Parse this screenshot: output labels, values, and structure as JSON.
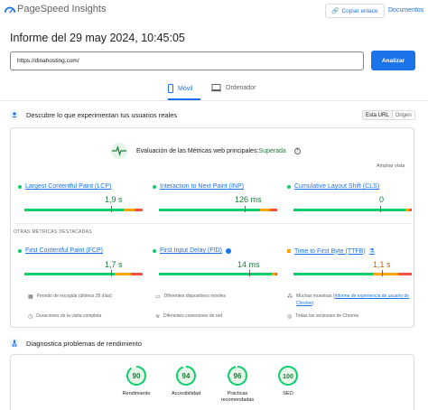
{
  "header": {
    "app_title": "PageSpeed Insights",
    "copy_link": "Copiar enlace",
    "docs": "Documentos"
  },
  "report": {
    "title": "Informe del 29 may 2024, 10:45:05"
  },
  "search": {
    "url_value": "https://dinahosting.com/",
    "analyze_label": "Analizar"
  },
  "tabs": [
    {
      "label": "Móvil",
      "active": true
    },
    {
      "label": "Ordenador",
      "active": false
    }
  ],
  "field": {
    "heading": "Descubre lo que experimentan tus usuarios reales",
    "toggle": [
      "Esta URL",
      "Origen"
    ],
    "cwv_title": "Evaluación de las Métricas web principales:",
    "cwv_status": "Superada",
    "expand": "Ampliar vista",
    "core_metrics": [
      {
        "name": "Largest Contentful Paint (LCP)",
        "value": "1,9 s",
        "indicator": "good"
      },
      {
        "name": "Interaction to Next Paint (INP)",
        "value": "126 ms",
        "indicator": "good"
      },
      {
        "name": "Cumulative Layout Shift (CLS)",
        "value": "0",
        "indicator": "good"
      }
    ],
    "other_label": "OTRAS MÉTRICAS DESTACADAS",
    "other_metrics": [
      {
        "name": "First Contentful Paint (FCP)",
        "value": "1,7 s",
        "indicator": "good"
      },
      {
        "name": "First Input Delay (FID)",
        "value": "14 ms",
        "indicator": "good"
      },
      {
        "name": "Time to First Byte (TTFB)",
        "value": "1,1 s",
        "indicator": "average"
      }
    ],
    "info": {
      "period": "Periodo de recogida (últimos 28 días)",
      "devices": "Diferentes dispositivos móviles",
      "samples_prefix": "Muchas muestras (",
      "samples_link": "Informe de experiencia de usuario de Chrome",
      "samples_suffix": ")",
      "duration": "Duraciones de la visita completa",
      "connections": "Diferentes conexiones de red",
      "chrome_versions": "Todas las versiones de Chrome"
    }
  },
  "diagnostics": {
    "heading": "Diagnostica problemas de rendimiento",
    "scores": [
      {
        "score": 90,
        "label": "Rendimiento"
      },
      {
        "score": 94,
        "label": "Accesibilidad"
      },
      {
        "score": 96,
        "label": "Prácticas recomendadas"
      },
      {
        "score": 100,
        "label": "SEO"
      }
    ]
  },
  "colors": {
    "accent": "#1a73e8",
    "good": "#0cce6b",
    "average": "#ffa400",
    "poor": "#ff4e42",
    "pass_text": "#188038"
  }
}
